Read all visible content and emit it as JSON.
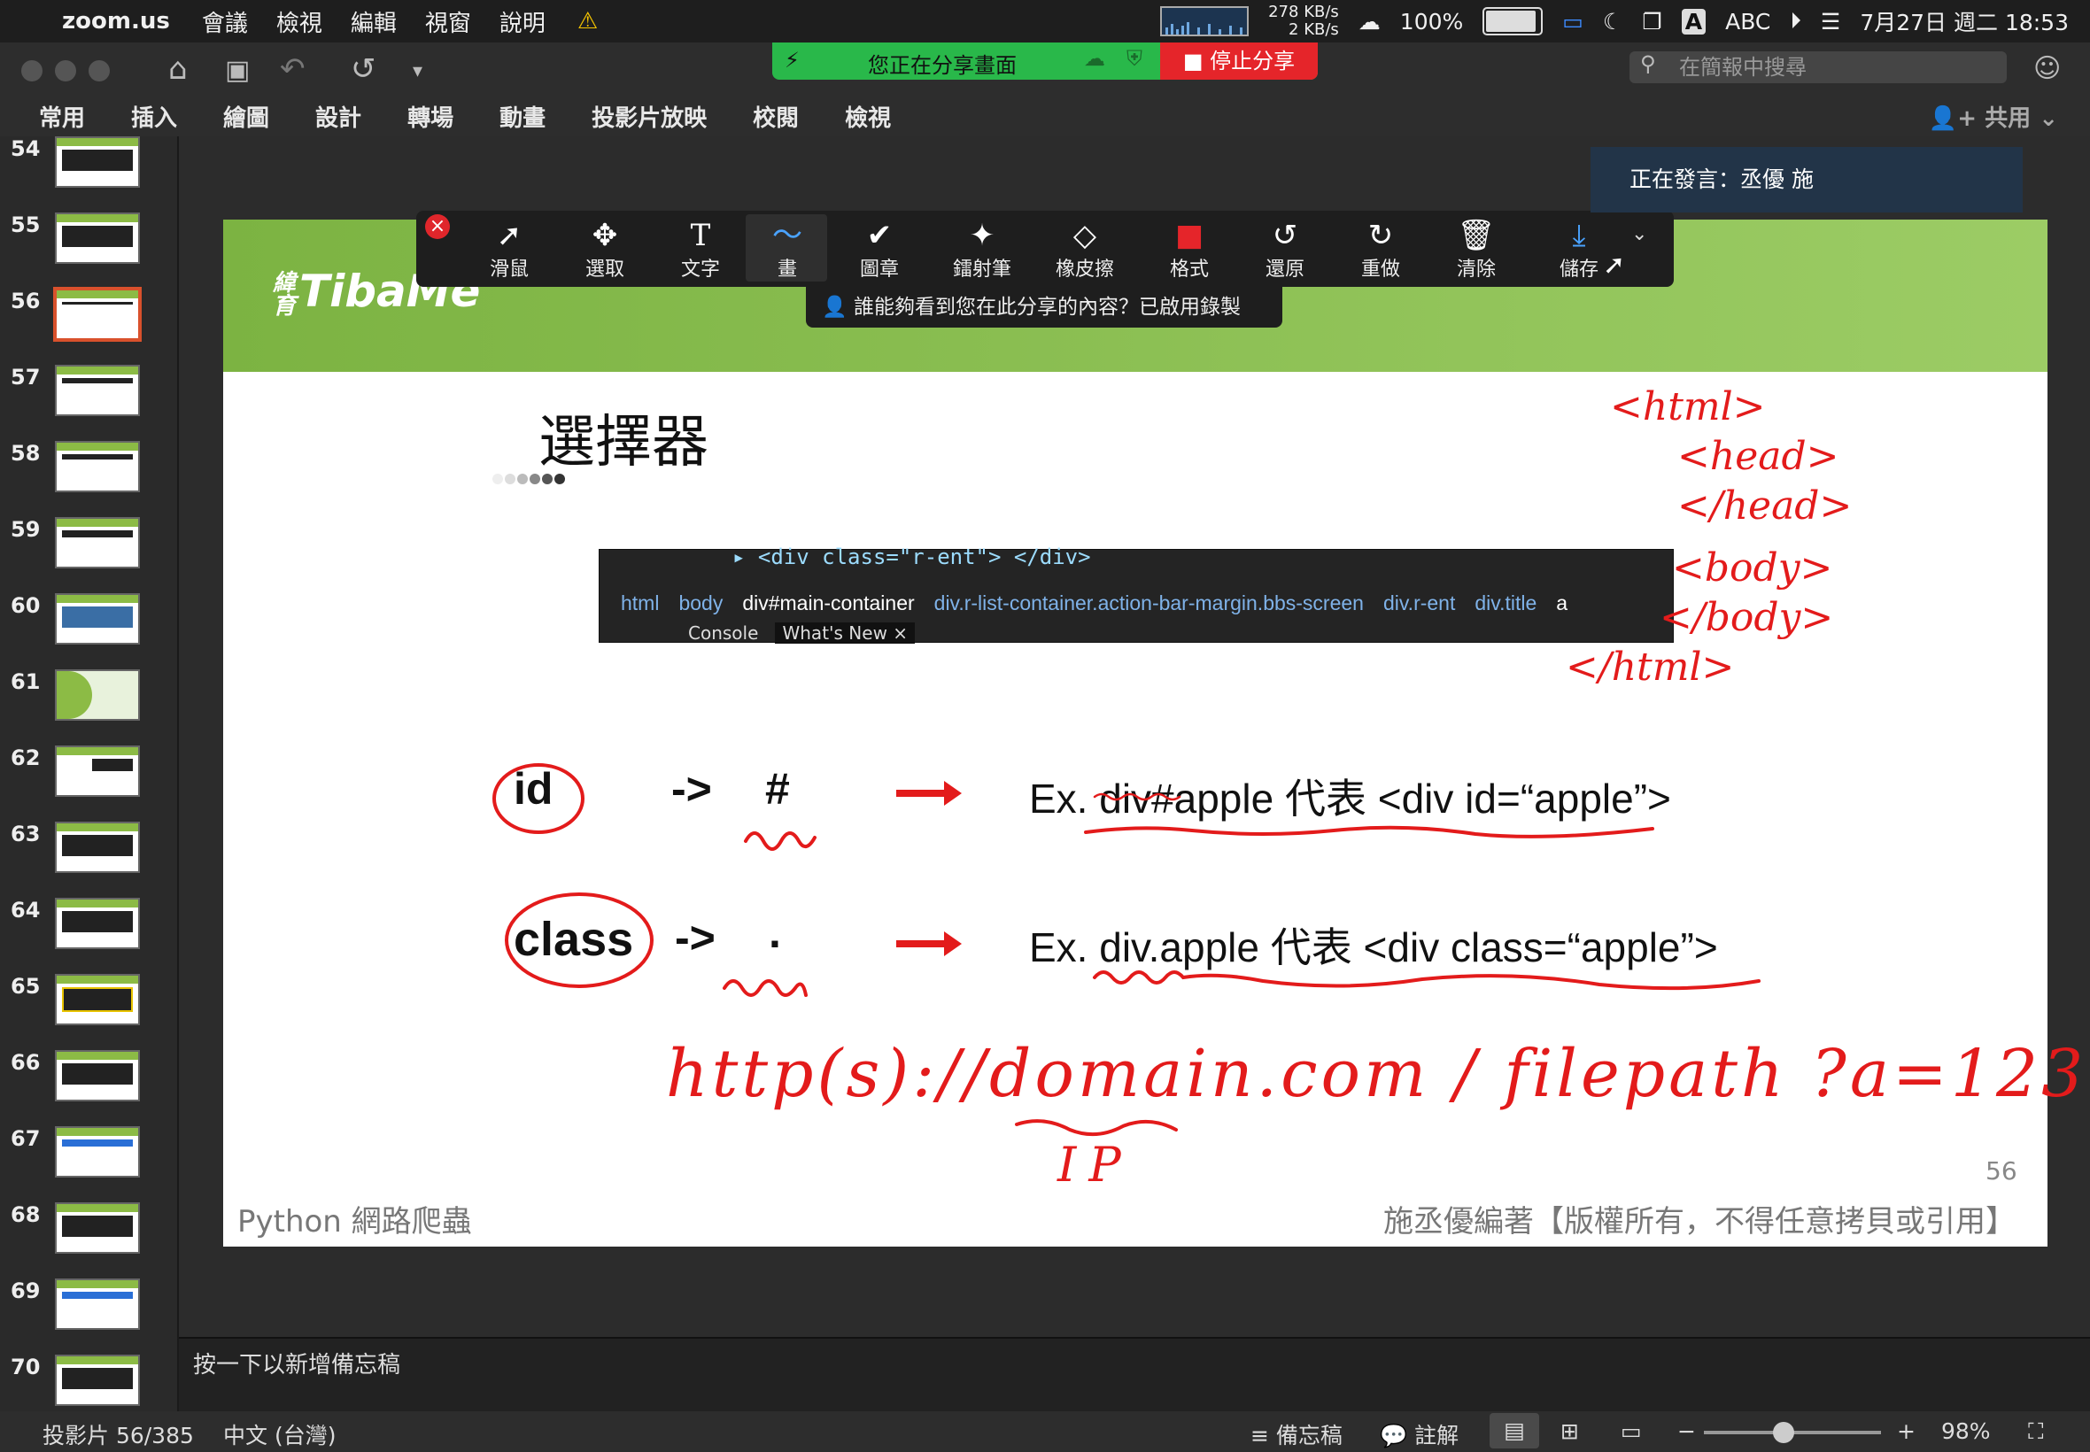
{
  "menubar": {
    "app": "zoom.us",
    "items": [
      "會議",
      "檢視",
      "編輯",
      "視窗",
      "說明"
    ],
    "network_up": "278 KB/s",
    "network_down": "2 KB/s",
    "battery": "100%",
    "input": "ABC",
    "datetime": "7月27日 週二 18:53"
  },
  "titlebar": {
    "search_placeholder": "在簡報中搜尋"
  },
  "share_bar": {
    "status": "您正在分享畫面",
    "stop_label": "停止分享"
  },
  "ribbon": {
    "tabs": [
      "常用",
      "插入",
      "繪圖",
      "設計",
      "轉場",
      "動畫",
      "投影片放映",
      "校閱",
      "檢視"
    ],
    "share_label": "共用"
  },
  "thumbnails": [
    "54",
    "55",
    "56",
    "57",
    "58",
    "59",
    "60",
    "61",
    "62",
    "63",
    "64",
    "65",
    "66",
    "67",
    "68",
    "69",
    "70"
  ],
  "selected_thumbnail": "56",
  "annotation_toolbar": {
    "tools": [
      {
        "label": "滑鼠",
        "icon": "pointer-icon",
        "glyph": "➚"
      },
      {
        "label": "選取",
        "icon": "move-icon",
        "glyph": "✥"
      },
      {
        "label": "文字",
        "icon": "text-icon",
        "glyph": "T"
      },
      {
        "label": "畫",
        "icon": "draw-icon",
        "glyph": "〜"
      },
      {
        "label": "圖章",
        "icon": "stamp-icon",
        "glyph": "✔"
      },
      {
        "label": "鐳射筆",
        "icon": "laser-icon",
        "glyph": "✦"
      },
      {
        "label": "橡皮擦",
        "icon": "eraser-icon",
        "glyph": "◇"
      },
      {
        "label": "格式",
        "icon": "format-icon",
        "glyph": "■"
      },
      {
        "label": "還原",
        "icon": "undo-icon",
        "glyph": "↺"
      },
      {
        "label": "重做",
        "icon": "redo-icon",
        "glyph": "↻"
      },
      {
        "label": "清除",
        "icon": "trash-icon",
        "glyph": "🗑"
      },
      {
        "label": "儲存",
        "icon": "save-icon",
        "glyph": "⤓"
      }
    ],
    "format_color": "#e5252a",
    "save_icon_color": "#4aa3ff"
  },
  "share_notice": "誰能夠看到您在此分享的內容？已啟用錄製",
  "speaker": "正在發言：丞優 施",
  "slide": {
    "logo_brand": "TibaMe",
    "logo_sub": "緯育",
    "title": "選擇器",
    "devtools": {
      "code_line": "▸ <div class=\"r-ent\"> </div>",
      "breadcrumbs": [
        "html",
        "body",
        "div#main-container",
        "div.r-list-container.action-bar-margin.bbs-screen",
        "div.r-ent",
        "div.title",
        "a"
      ],
      "tabs": [
        "Console",
        "What's New ×"
      ]
    },
    "rows": [
      {
        "key": "id",
        "arrow": "->",
        "symbol": "#",
        "example": "Ex. div#apple 代表 <div id=“apple”>"
      },
      {
        "key": "class",
        "arrow": "->",
        "symbol": ".",
        "example": "Ex. div.apple 代表 <div class=“apple”>"
      }
    ],
    "page_number": "56",
    "footer_left": "Python 網路爬蟲",
    "footer_right": "施丞優編著【版權所有，不得任意拷貝或引用】"
  },
  "handwriting": {
    "html_tree": [
      "<html>",
      "<head>",
      "</head>",
      "<body>",
      "</body>",
      "</html>"
    ],
    "url": "http(s)://domain.com / filepath ?a=123",
    "ip": "IP"
  },
  "notes_placeholder": "按一下以新增備忘稿",
  "statusbar": {
    "slide_info": "投影片 56/385",
    "language": "中文 (台灣)",
    "notes_label": "備忘稿",
    "comments_label": "註解",
    "zoom": "98%",
    "zoom_fraction": 0.45
  },
  "colors": {
    "accent_green": "#8cbb45",
    "ink_red": "#e31b1b",
    "share_green": "#29b84a"
  }
}
